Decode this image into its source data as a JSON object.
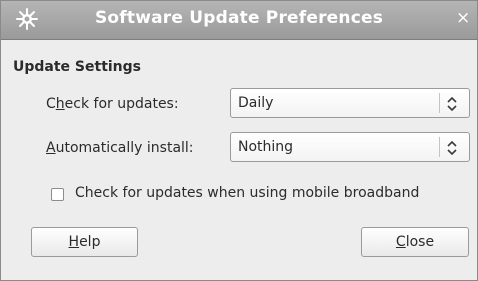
{
  "window": {
    "title": "Software Update Preferences",
    "close_glyph": "×",
    "title_icon": "gear-star-icon"
  },
  "section": {
    "title": "Update Settings"
  },
  "check_for_updates": {
    "label_mnemonic_pre": "C",
    "label_mnemonic": "h",
    "label_mnemonic_post": "eck for updates:",
    "value": "Daily"
  },
  "auto_install": {
    "label_mnemonic": "A",
    "label_mnemonic_post": "utomatically install:",
    "value": "Nothing"
  },
  "mobile_broadband": {
    "label": "Check for updates when using mobile broadband",
    "checked": false
  },
  "buttons": {
    "help_mnemonic": "H",
    "help_rest": "elp",
    "close_mnemonic": "C",
    "close_rest": "lose"
  },
  "colors": {
    "titlebar": "#a8a8a8",
    "window_bg": "#ededed",
    "text": "#2b2b2b"
  }
}
